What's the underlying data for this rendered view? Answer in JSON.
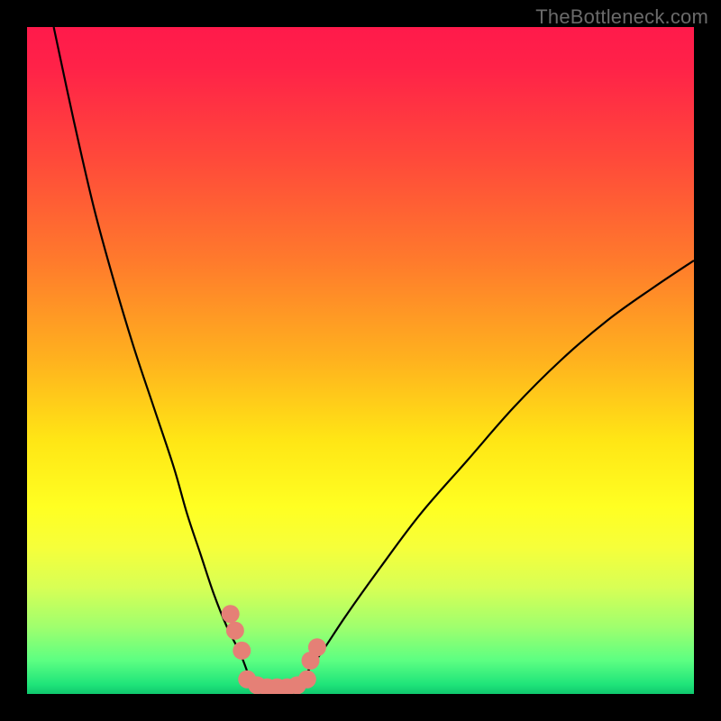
{
  "watermark": {
    "text": "TheBottleneck.com"
  },
  "colors": {
    "frame": "#000000",
    "curve": "#000000",
    "marker_fill": "#e58076",
    "gradient_stops": [
      {
        "offset": 0.0,
        "color": "#ff1a4b"
      },
      {
        "offset": 0.06,
        "color": "#ff2248"
      },
      {
        "offset": 0.2,
        "color": "#ff4a3a"
      },
      {
        "offset": 0.35,
        "color": "#ff7a2c"
      },
      {
        "offset": 0.5,
        "color": "#ffb21e"
      },
      {
        "offset": 0.62,
        "color": "#ffe615"
      },
      {
        "offset": 0.72,
        "color": "#ffff22"
      },
      {
        "offset": 0.78,
        "color": "#f6ff3a"
      },
      {
        "offset": 0.84,
        "color": "#d8ff55"
      },
      {
        "offset": 0.9,
        "color": "#9fff6e"
      },
      {
        "offset": 0.95,
        "color": "#5cff82"
      },
      {
        "offset": 0.985,
        "color": "#20e57a"
      },
      {
        "offset": 1.0,
        "color": "#10c86e"
      }
    ]
  },
  "chart_data": {
    "type": "line",
    "title": "",
    "xlabel": "",
    "ylabel": "",
    "xlim": [
      0,
      100
    ],
    "ylim": [
      0,
      100
    ],
    "grid": false,
    "series": [
      {
        "name": "left-branch",
        "x": [
          4,
          7,
          10,
          13,
          16,
          19,
          22,
          24,
          26,
          28,
          30,
          32,
          33.5
        ],
        "y": [
          100,
          86,
          73,
          62,
          52,
          43,
          34,
          27,
          21,
          15,
          10,
          6,
          2
        ]
      },
      {
        "name": "right-branch",
        "x": [
          41,
          44,
          48,
          53,
          59,
          66,
          73,
          80,
          87,
          94,
          100
        ],
        "y": [
          2,
          6,
          12,
          19,
          27,
          35,
          43,
          50,
          56,
          61,
          65
        ]
      },
      {
        "name": "valley-floor",
        "x": [
          33.5,
          35,
          37,
          39,
          41
        ],
        "y": [
          2,
          1,
          1,
          1,
          2
        ]
      },
      {
        "name": "markers-left",
        "marker": true,
        "x": [
          30.5,
          31.2,
          32.2
        ],
        "y": [
          12,
          9.5,
          6.5
        ]
      },
      {
        "name": "markers-right",
        "marker": true,
        "x": [
          42.5,
          43.5
        ],
        "y": [
          5,
          7
        ]
      },
      {
        "name": "markers-floor",
        "marker": true,
        "x": [
          33,
          34.5,
          36,
          37.5,
          39,
          40.5,
          42
        ],
        "y": [
          2.2,
          1.3,
          1.0,
          1.0,
          1.0,
          1.3,
          2.2
        ]
      }
    ]
  }
}
